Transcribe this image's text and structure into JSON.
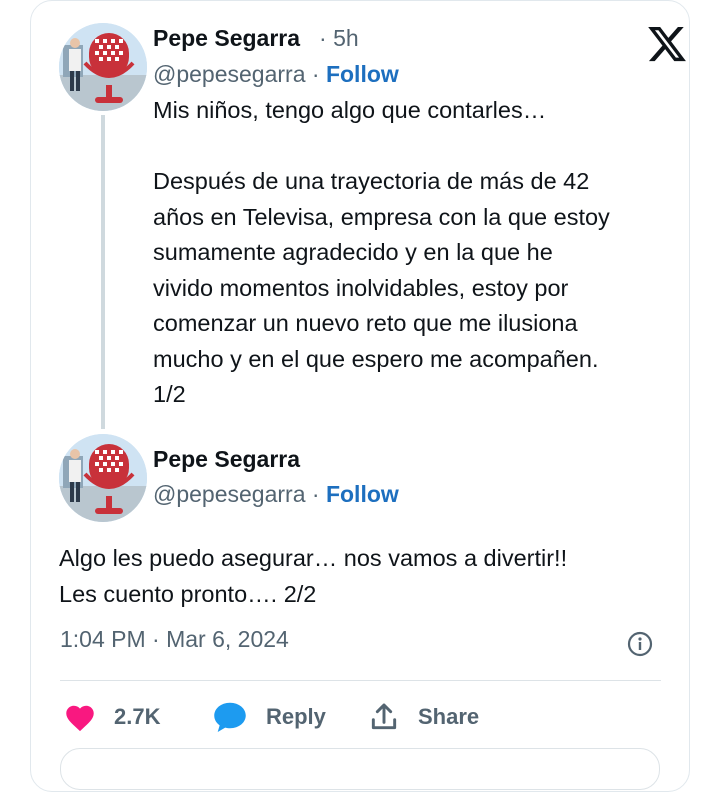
{
  "tweet1": {
    "author": "Pepe Segarra",
    "separator": "·",
    "time_ago": "5h",
    "handle": "@pepesegarra",
    "follow_sep": "·",
    "follow_label": "Follow",
    "text": "Mis niños, tengo algo que contarles…\n\nDespués de una trayectoria de más de 42\naños en Televisa, empresa con la que estoy\nsumamente agradecido y en la que he\nvivido momentos inolvidables, estoy por\ncomenzar un nuevo reto que me ilusiona\nmucho y en el que espero me acompañen.\n1/2"
  },
  "tweet2": {
    "author": "Pepe Segarra",
    "handle": "@pepesegarra",
    "follow_sep": "·",
    "follow_label": "Follow",
    "text": "Algo les puedo asegurar… nos vamos a divertir!!\nLes cuento pronto…. 2/2",
    "timestamp": "1:04 PM · Mar 6, 2024"
  },
  "actions": {
    "likes": "2.7K",
    "reply_label": "Reply",
    "share_label": "Share"
  },
  "icons": {
    "brand": "x-logo-icon",
    "info": "info-icon",
    "like": "heart-icon",
    "reply": "reply-bubble-icon",
    "share": "share-arrow-icon"
  },
  "colors": {
    "follow": "#1d6fbf",
    "heart": "#f91880",
    "reply": "#1d9bf0",
    "muted": "#536471",
    "mic": "#c8313a"
  }
}
